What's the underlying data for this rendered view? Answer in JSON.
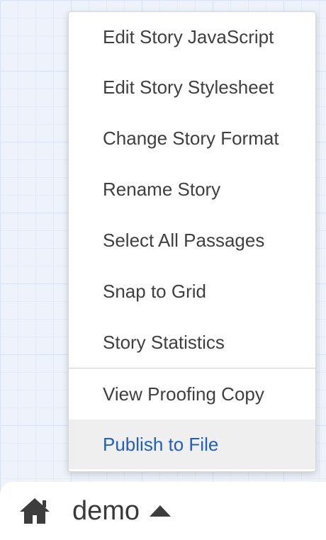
{
  "menu": {
    "items": [
      {
        "label": "Edit Story JavaScript"
      },
      {
        "label": "Edit Story Stylesheet"
      },
      {
        "label": "Change Story Format"
      },
      {
        "label": "Rename Story"
      },
      {
        "label": "Select All Passages"
      },
      {
        "label": "Snap to Grid"
      },
      {
        "label": "Story Statistics"
      },
      {
        "label": "View Proofing Copy"
      },
      {
        "label": "Publish to File"
      }
    ]
  },
  "toolbar": {
    "home_icon": "home-icon",
    "story_name": "demo",
    "caret_icon": "caret-up-icon"
  },
  "colors": {
    "highlight_text": "#1f5fc3",
    "highlight_bg": "#efefef",
    "menu_text": "#3f3f3f"
  }
}
